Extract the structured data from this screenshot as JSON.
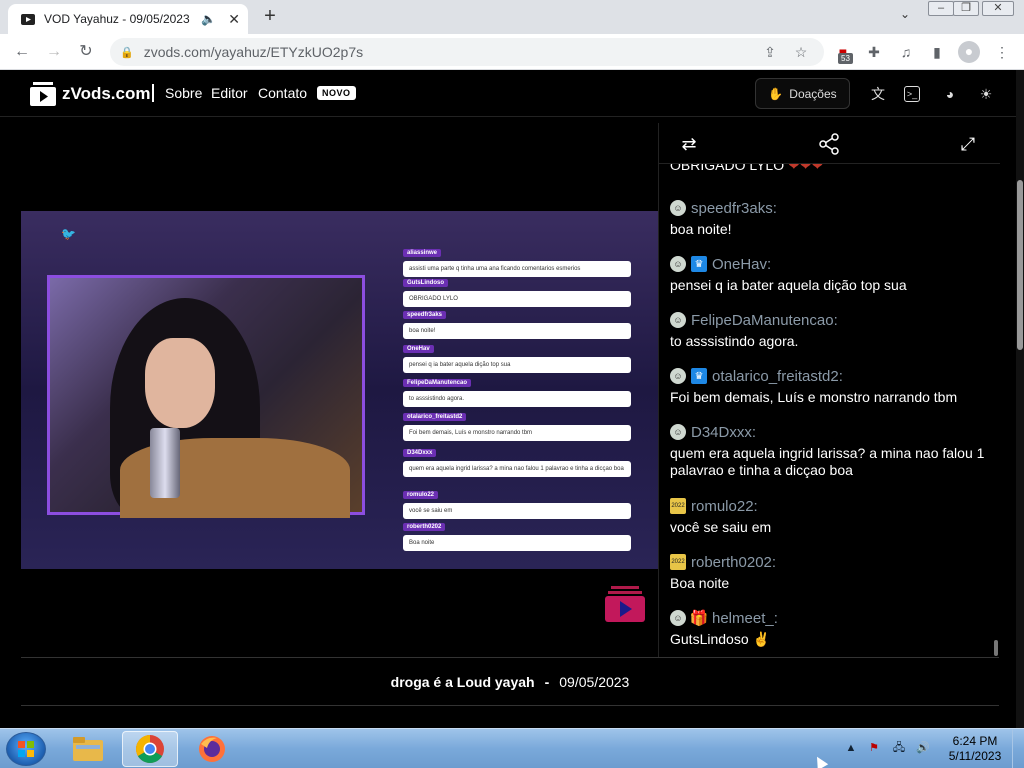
{
  "browser": {
    "tab_title": "VOD Yayahuz - 09/05/2023 |",
    "url": "zvods.com/yayahuz/ETYzkUO2p7s",
    "extension_badge": "53"
  },
  "site": {
    "logo": "zVods.com",
    "nav": [
      "Sobre",
      "Editor",
      "Contato"
    ],
    "new_badge": "NOVO",
    "donate_label": "Doações"
  },
  "overlay_chat": [
    {
      "user": "aliassinwe",
      "msg": "assisti uma parte q tinha uma ana ficando comentarios esmerios"
    },
    {
      "user": "GutsLindoso",
      "msg": "OBRIGADO LYLO"
    },
    {
      "user": "speedfr3aks",
      "msg": "boa noite!"
    },
    {
      "user": "OneHav",
      "msg": "pensei q ia bater aquela dição top sua"
    },
    {
      "user": "FelipeDaManutencao",
      "msg": "to asssistindo agora."
    },
    {
      "user": "otalarico_freitastd2",
      "msg": "Foi bem demais, Luís e monstro narrando tbm"
    },
    {
      "user": "D34Dxxx",
      "msg": "quem era aquela ingrid larissa? a mina nao falou 1 palavrao e tinha a dicçao boa"
    },
    {
      "user": "romulo22",
      "msg": "você se saiu em"
    },
    {
      "user": "roberth0202",
      "msg": "Boa noite"
    }
  ],
  "chat": {
    "partial_message": "OBRIGADO LYLO",
    "messages": [
      {
        "user": "speedfr3aks:",
        "text": "boa noite!",
        "badge": null
      },
      {
        "user": "OneHav:",
        "text": "pensei q ia bater aquela dição top sua",
        "badge": "crown"
      },
      {
        "user": "FelipeDaManutencao:",
        "text": "to asssistindo agora.",
        "badge": null
      },
      {
        "user": "otalarico_freitastd2:",
        "text": "Foi bem demais, Luís e monstro narrando tbm",
        "badge": "crown"
      },
      {
        "user": "D34Dxxx:",
        "text": "quem era aquela ingrid larissa? a mina nao falou 1 palavrao e tinha a dicçao boa",
        "badge": null
      },
      {
        "user": "romulo22:",
        "text": "você se saiu em",
        "badge": "2022"
      },
      {
        "user": "roberth0202:",
        "text": "Boa noite",
        "badge": "2022"
      },
      {
        "user": "helmeet_:",
        "text": "GutsLindoso ✌",
        "badge": "gift"
      }
    ]
  },
  "video": {
    "title": "droga é a Loud yayah",
    "separator": "-",
    "date": "09/05/2023"
  },
  "taskbar": {
    "time": "6:24 PM",
    "date": "5/11/2023"
  },
  "colors": {
    "accent_purple": "#8c4ee0",
    "badge_blue": "#1e88e5"
  }
}
